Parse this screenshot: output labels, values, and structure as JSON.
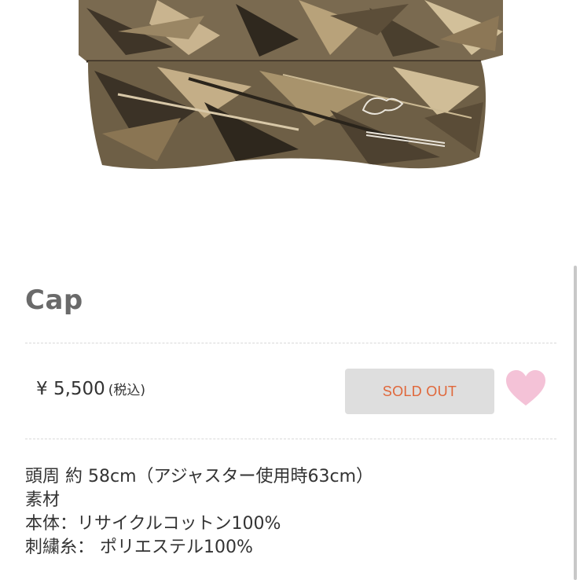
{
  "product": {
    "title": "Cap",
    "price": "¥ 5,500",
    "tax_note": "(税込)",
    "status_button": "SOLD OUT",
    "image_icon": "camo-cap-photo",
    "favorite_icon": "heart-icon",
    "description": [
      "頭周 約 58cm（アジャスター使用時63cm）",
      "素材",
      "本体：リサイクルコットン100%",
      "刺繍糸： ポリエステル100%"
    ]
  },
  "colors": {
    "sold_out_text": "#e0673a",
    "sold_out_bg": "#dedede",
    "heart": "#f4c2d7",
    "title": "#6a6a6a"
  }
}
